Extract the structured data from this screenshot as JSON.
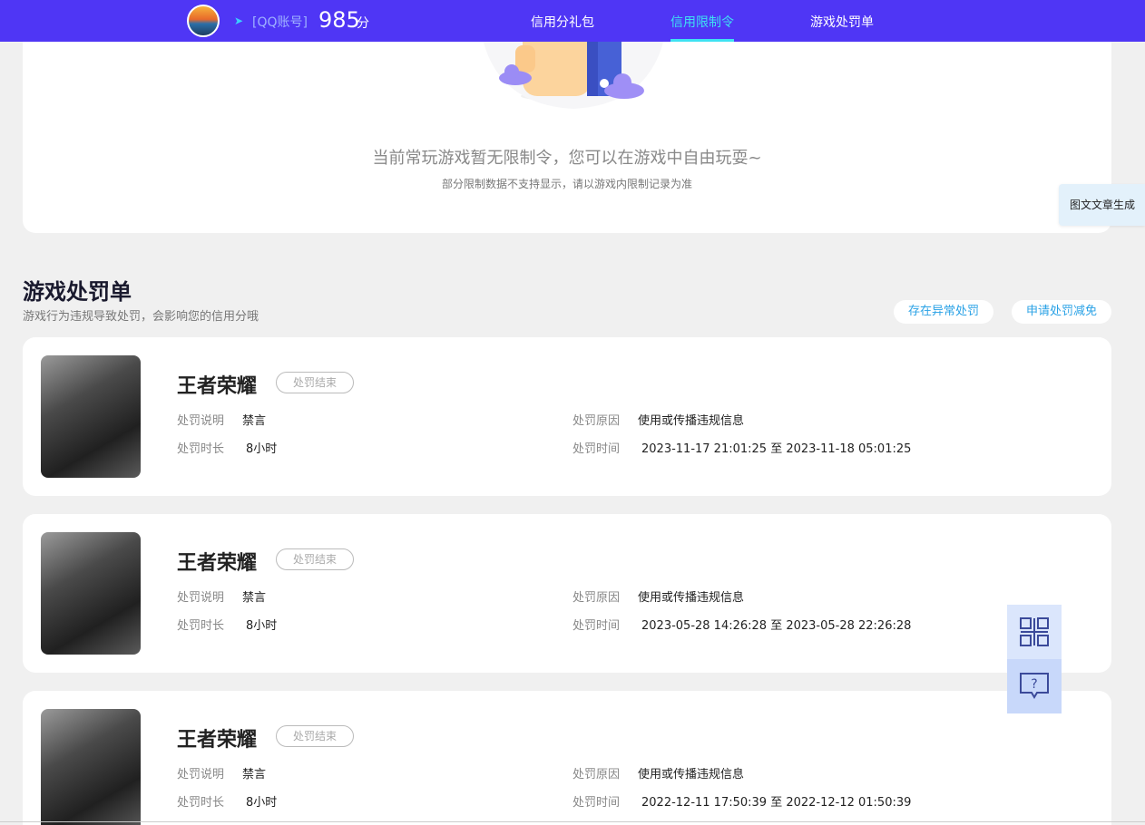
{
  "header": {
    "account_label": "[QQ账号]",
    "score": "985",
    "score_unit": "分",
    "nav": [
      {
        "label": "信用分礼包",
        "active": false
      },
      {
        "label": "信用限制令",
        "active": true
      },
      {
        "label": "游戏处罚单",
        "active": false
      }
    ],
    "accent": "#4f36f5",
    "active_color": "#3ee2f2"
  },
  "restriction": {
    "message": "当前常玩游戏暂无限制令，您可以在游戏中自由玩耍~",
    "note": "部分限制数据不支持显示，请以游戏内限制记录为准"
  },
  "side_tab": {
    "label": "图文文章生成"
  },
  "punishments_section": {
    "title": "游戏处罚单",
    "subtitle": "游戏行为违规导致处罚，会影响您的信用分哦",
    "actions": [
      "存在异常处罚",
      "申请处罚减免"
    ]
  },
  "labels": {
    "desc": "处罚说明",
    "duration": "处罚时长",
    "reason": "处罚原因",
    "time": "处罚时间"
  },
  "records": [
    {
      "game": "王者荣耀",
      "status": "处罚结束",
      "desc": "禁言",
      "duration": "8小时",
      "reason": "使用或传播违规信息",
      "time": "2023-11-17 21:01:25 至 2023-11-18 05:01:25"
    },
    {
      "game": "王者荣耀",
      "status": "处罚结束",
      "desc": "禁言",
      "duration": "8小时",
      "reason": "使用或传播违规信息",
      "time": "2023-05-28 14:26:28 至 2023-05-28 22:26:28"
    },
    {
      "game": "王者荣耀",
      "status": "处罚结束",
      "desc": "禁言",
      "duration": "8小时",
      "reason": "使用或传播违规信息",
      "time": "2022-12-11 17:50:39 至 2022-12-12 01:50:39"
    }
  ],
  "floating": {
    "icons": [
      "qr-code-icon",
      "help-chat-icon"
    ]
  }
}
